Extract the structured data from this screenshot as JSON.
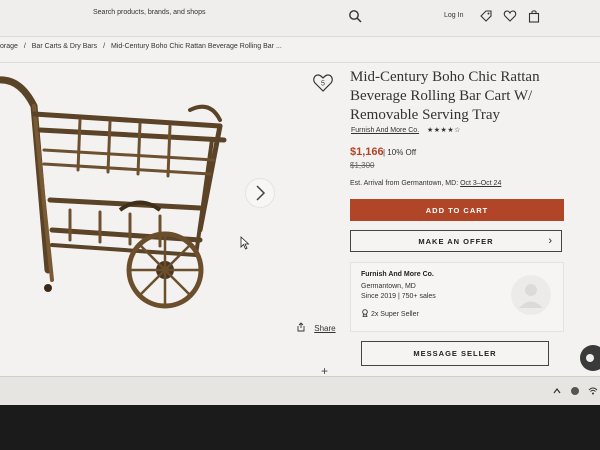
{
  "header": {
    "search_placeholder": "Search products, brands, and shops",
    "login_label": "Log In",
    "icons": [
      "search-icon",
      "tag-icon",
      "heart-icon",
      "bag-icon"
    ]
  },
  "breadcrumb": [
    "orage",
    "/",
    "Bar Carts & Dry Bars",
    "/",
    "Mid-Century Boho Chic Rattan Beverage Rolling Bar ..."
  ],
  "product": {
    "title": "Mid-Century Boho Chic Rattan Beverage Rolling Bar Cart W/ Removable Serving Tray",
    "favorites_count": "5",
    "seller_link": "Furnish And More Co.",
    "rating_stars": "★★★★☆",
    "price": "$1,166",
    "discount": "| 10% Off",
    "original_price": "$1,300",
    "arrival_label": "Est. Arrival from Germantown, MD:",
    "arrival_dates": "Oct 3–Oct 24",
    "add_to_cart_label": "ADD TO CART",
    "make_offer_label": "MAKE AN OFFER",
    "share_label": "Share"
  },
  "seller": {
    "name": "Furnish And More Co.",
    "location": "Germantown, MD",
    "since": "Since 2019  |  750+ sales",
    "badge": "2x Super Seller",
    "message_label": "MESSAGE SELLER"
  },
  "colors": {
    "accent": "#b14528",
    "background": "#f3f2f0"
  }
}
